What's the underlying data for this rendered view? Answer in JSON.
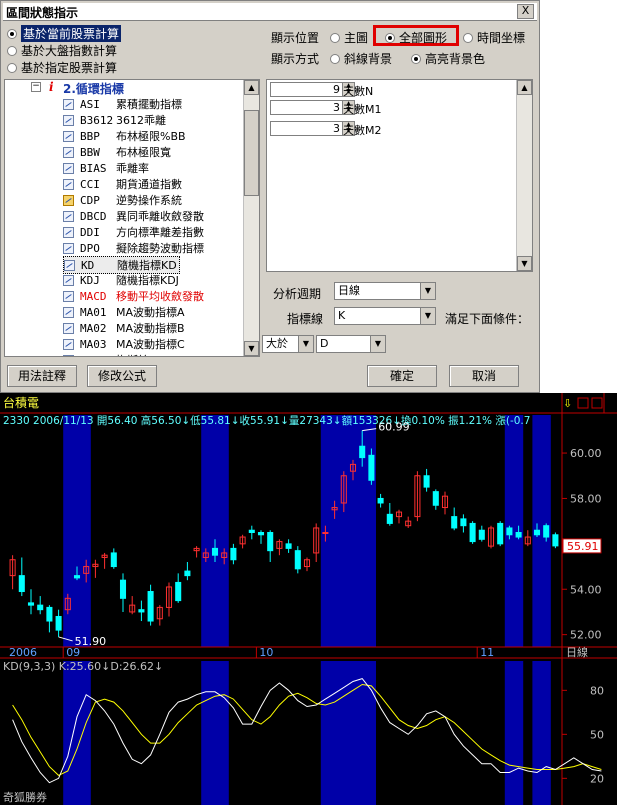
{
  "dialog": {
    "title": "區間狀態指示",
    "close": "X",
    "calc_options": [
      {
        "label": "基於當前股票計算",
        "checked": true
      },
      {
        "label": "基於大盤指數計算",
        "checked": false
      },
      {
        "label": "基於指定股票計算",
        "checked": false
      }
    ],
    "display_position": {
      "label": "顯示位置",
      "options": [
        {
          "label": "主圖",
          "checked": false
        },
        {
          "label": "全部圖形",
          "checked": true
        },
        {
          "label": "時間坐標",
          "checked": false
        }
      ]
    },
    "display_mode": {
      "label": "顯示方式",
      "options": [
        {
          "label": "斜線背景",
          "checked": false
        },
        {
          "label": "高亮背景色",
          "checked": true
        }
      ]
    },
    "tree": {
      "group_marker": "i",
      "group": "2.循環指標",
      "items": [
        {
          "code": "ASI",
          "name": "累積擺動指標",
          "red": false
        },
        {
          "code": "B3612",
          "name": "3612乖離",
          "red": false
        },
        {
          "code": "BBP",
          "name": "布林極限%BB",
          "red": false
        },
        {
          "code": "BBW",
          "name": "布林極限寬",
          "red": false
        },
        {
          "code": "BIAS",
          "name": "乖離率",
          "red": false
        },
        {
          "code": "CCI",
          "name": "期貨通道指數",
          "red": false
        },
        {
          "code": "CDP",
          "name": "逆勢操作系統",
          "red": false
        },
        {
          "code": "DBCD",
          "name": "異同乖離收斂發散",
          "red": false
        },
        {
          "code": "DDI",
          "name": "方向標準離差指數",
          "red": false
        },
        {
          "code": "DPO",
          "name": "擬除趨勢波動指標",
          "red": false
        },
        {
          "code": "KD",
          "name": "隨機指標KD",
          "red": false
        },
        {
          "code": "KDJ",
          "name": "隨機指標KDJ",
          "red": false
        },
        {
          "code": "MACD",
          "name": "移動平均收斂發散",
          "red": true
        },
        {
          "code": "MA01",
          "name": "MA波動指標A",
          "red": false
        },
        {
          "code": "MA02",
          "name": "MA波動指標B",
          "red": false
        },
        {
          "code": "MA03",
          "name": "MA波動指標C",
          "red": false
        },
        {
          "code": "MASS",
          "name": "梅斯線",
          "red": false
        }
      ]
    },
    "params": [
      {
        "value": "9",
        "label": "天數N"
      },
      {
        "value": "3",
        "label": "天數M1"
      },
      {
        "value": "3",
        "label": "天數M2"
      }
    ],
    "analysis_period": {
      "label": "分析週期",
      "value": "日線"
    },
    "indicator_line": {
      "label": "指標線",
      "value": "K"
    },
    "condition_label": "滿足下面條件：",
    "cond_op": "大於",
    "cond_target": "D",
    "buttons": {
      "help": "用法註釋",
      "edit": "修改公式",
      "ok": "確定",
      "cancel": "取消"
    }
  },
  "chart": {
    "stock_name": "台積電",
    "info": "2330  2006/11/13  開56.40  高56.50↓低55.81↓收55.91↓量27343↓額153326↓換0.10% 振1.21% 漲(-0.7",
    "high_label": "60.99",
    "low_label": "51.90",
    "last_price": "55.91",
    "price_ticks": [
      "60.00",
      "58.00",
      "56.00",
      "54.00",
      "52.00"
    ],
    "x_labels": [
      "2006",
      "09",
      "10",
      "11"
    ],
    "period": "日線",
    "kd_header": "KD(9,3,3)  K:25.60↓D:26.62↓",
    "kd_ticks": [
      "80",
      "50",
      "20"
    ],
    "watermark": "奇狐勝券",
    "colors": {
      "up": "#ff3030",
      "down": "#00ffff",
      "band": "#0000a8",
      "k_line": "#ffffff",
      "d_line": "#ffff00",
      "axis": "#c00000"
    },
    "chart_data": {
      "type": "candlestick",
      "ylim": [
        51.5,
        61.5
      ],
      "candles": [
        {
          "o": 54.6,
          "h": 55.5,
          "l": 54.0,
          "c": 55.3
        },
        {
          "o": 54.6,
          "h": 55.4,
          "l": 53.7,
          "c": 53.9
        },
        {
          "o": 53.4,
          "h": 54.0,
          "l": 52.9,
          "c": 53.3
        },
        {
          "o": 53.3,
          "h": 53.7,
          "l": 52.9,
          "c": 53.1
        },
        {
          "o": 53.2,
          "h": 53.3,
          "l": 52.1,
          "c": 52.6
        },
        {
          "o": 52.8,
          "h": 53.1,
          "l": 51.9,
          "c": 52.2
        },
        {
          "o": 53.1,
          "h": 53.8,
          "l": 52.9,
          "c": 53.6
        },
        {
          "o": 54.6,
          "h": 55.0,
          "l": 54.4,
          "c": 54.5
        },
        {
          "o": 54.7,
          "h": 55.3,
          "l": 54.3,
          "c": 55.0
        },
        {
          "o": 55.0,
          "h": 55.3,
          "l": 54.5,
          "c": 55.1
        },
        {
          "o": 55.4,
          "h": 55.6,
          "l": 54.9,
          "c": 55.5
        },
        {
          "o": 55.6,
          "h": 55.8,
          "l": 54.9,
          "c": 55.0
        },
        {
          "o": 54.4,
          "h": 54.7,
          "l": 53.0,
          "c": 53.6
        },
        {
          "o": 53.0,
          "h": 53.7,
          "l": 52.9,
          "c": 53.3
        },
        {
          "o": 53.1,
          "h": 53.5,
          "l": 52.6,
          "c": 53.0
        },
        {
          "o": 53.9,
          "h": 54.2,
          "l": 52.4,
          "c": 52.6
        },
        {
          "o": 52.7,
          "h": 53.3,
          "l": 52.4,
          "c": 53.2
        },
        {
          "o": 53.2,
          "h": 54.3,
          "l": 52.8,
          "c": 54.1
        },
        {
          "o": 54.3,
          "h": 54.7,
          "l": 53.4,
          "c": 53.5
        },
        {
          "o": 54.8,
          "h": 55.2,
          "l": 54.4,
          "c": 54.6
        },
        {
          "o": 55.7,
          "h": 55.9,
          "l": 55.4,
          "c": 55.8
        },
        {
          "o": 55.4,
          "h": 55.8,
          "l": 55.2,
          "c": 55.6
        },
        {
          "o": 55.8,
          "h": 56.2,
          "l": 55.2,
          "c": 55.5
        },
        {
          "o": 55.4,
          "h": 55.8,
          "l": 55.1,
          "c": 55.6
        },
        {
          "o": 55.8,
          "h": 56.0,
          "l": 55.1,
          "c": 55.3
        },
        {
          "o": 56.0,
          "h": 56.4,
          "l": 55.8,
          "c": 56.3
        },
        {
          "o": 56.6,
          "h": 56.8,
          "l": 56.2,
          "c": 56.5
        },
        {
          "o": 56.5,
          "h": 56.6,
          "l": 56.0,
          "c": 56.4
        },
        {
          "o": 56.5,
          "h": 56.6,
          "l": 55.2,
          "c": 55.7
        },
        {
          "o": 55.8,
          "h": 56.2,
          "l": 55.5,
          "c": 56.1
        },
        {
          "o": 56.0,
          "h": 56.2,
          "l": 55.6,
          "c": 55.8
        },
        {
          "o": 55.7,
          "h": 55.9,
          "l": 54.7,
          "c": 54.9
        },
        {
          "o": 55.0,
          "h": 55.4,
          "l": 54.8,
          "c": 55.3
        },
        {
          "o": 55.6,
          "h": 56.9,
          "l": 55.2,
          "c": 56.7
        },
        {
          "o": 56.5,
          "h": 56.8,
          "l": 56.1,
          "c": 56.5
        },
        {
          "o": 57.5,
          "h": 57.9,
          "l": 57.1,
          "c": 57.6
        },
        {
          "o": 57.8,
          "h": 59.2,
          "l": 57.4,
          "c": 59.0
        },
        {
          "o": 59.2,
          "h": 59.7,
          "l": 58.8,
          "c": 59.5
        },
        {
          "o": 60.3,
          "h": 60.99,
          "l": 59.4,
          "c": 59.8
        },
        {
          "o": 59.9,
          "h": 60.2,
          "l": 58.6,
          "c": 58.8
        },
        {
          "o": 58.0,
          "h": 58.2,
          "l": 57.6,
          "c": 57.8
        },
        {
          "o": 57.3,
          "h": 57.8,
          "l": 56.8,
          "c": 56.9
        },
        {
          "o": 57.2,
          "h": 57.5,
          "l": 56.9,
          "c": 57.4
        },
        {
          "o": 56.8,
          "h": 57.2,
          "l": 56.7,
          "c": 57.0
        },
        {
          "o": 57.2,
          "h": 59.2,
          "l": 57.0,
          "c": 59.0
        },
        {
          "o": 59.0,
          "h": 59.3,
          "l": 58.3,
          "c": 58.5
        },
        {
          "o": 58.3,
          "h": 58.4,
          "l": 57.5,
          "c": 57.7
        },
        {
          "o": 57.6,
          "h": 58.3,
          "l": 57.3,
          "c": 58.1
        },
        {
          "o": 57.2,
          "h": 57.6,
          "l": 56.6,
          "c": 56.7
        },
        {
          "o": 57.1,
          "h": 57.3,
          "l": 56.5,
          "c": 56.8
        },
        {
          "o": 56.9,
          "h": 57.0,
          "l": 56.0,
          "c": 56.1
        },
        {
          "o": 56.6,
          "h": 56.8,
          "l": 56.1,
          "c": 56.2
        },
        {
          "o": 55.9,
          "h": 56.8,
          "l": 55.8,
          "c": 56.7
        },
        {
          "o": 56.9,
          "h": 57.0,
          "l": 55.9,
          "c": 56.0
        },
        {
          "o": 56.7,
          "h": 56.8,
          "l": 56.2,
          "c": 56.4
        },
        {
          "o": 56.5,
          "h": 56.8,
          "l": 56.2,
          "c": 56.3
        },
        {
          "o": 56.0,
          "h": 56.6,
          "l": 55.9,
          "c": 56.3
        },
        {
          "o": 56.6,
          "h": 56.9,
          "l": 56.3,
          "c": 56.4
        },
        {
          "o": 56.8,
          "h": 56.9,
          "l": 56.1,
          "c": 56.3
        },
        {
          "o": 56.4,
          "h": 56.5,
          "l": 55.81,
          "c": 55.91
        }
      ],
      "bands": [
        [
          6,
          8
        ],
        [
          21,
          23
        ],
        [
          34,
          39
        ],
        [
          54,
          55
        ],
        [
          57,
          58
        ]
      ],
      "kd": {
        "ylim": [
          10,
          100
        ],
        "k": [
          60,
          45,
          34,
          24,
          17,
          20,
          35,
          62,
          77,
          73,
          66,
          57,
          44,
          33,
          30,
          36,
          50,
          65,
          72,
          74,
          77,
          79,
          79,
          75,
          68,
          57,
          57,
          69,
          80,
          85,
          80,
          73,
          69,
          70,
          74,
          78,
          82,
          86,
          88,
          80,
          68,
          58,
          54,
          50,
          56,
          64,
          66,
          62,
          50,
          42,
          36,
          30,
          30,
          24,
          24,
          27,
          25,
          24,
          28,
          26,
          30,
          34,
          30,
          26,
          25
        ],
        "d": [
          70,
          60,
          48,
          38,
          28,
          22,
          25,
          40,
          58,
          72,
          74,
          72,
          66,
          58,
          50,
          44,
          44,
          50,
          58,
          64,
          70,
          73,
          76,
          77,
          74,
          67,
          60,
          57,
          62,
          70,
          76,
          78,
          75,
          71,
          70,
          72,
          76,
          80,
          84,
          83,
          76,
          68,
          60,
          56,
          54,
          56,
          60,
          62,
          58,
          52,
          46,
          40,
          36,
          32,
          29,
          28,
          27,
          26,
          26,
          26,
          27,
          28,
          30,
          28,
          26
        ]
      }
    }
  }
}
